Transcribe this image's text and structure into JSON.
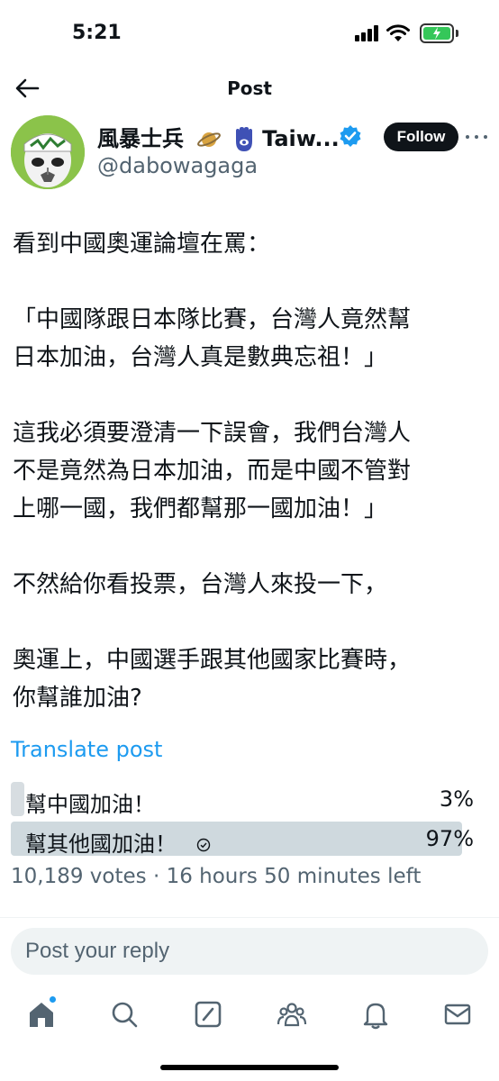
{
  "status_bar": {
    "time": "5:21"
  },
  "header": {
    "title": "Post"
  },
  "author": {
    "display_name": "風暴士兵",
    "name_suffix": "Taiw...",
    "emojis": [
      "saturn-emoji",
      "hamsa-emoji"
    ],
    "handle": "@dabowagaga",
    "follow_label": "Follow"
  },
  "post": {
    "lines": [
      "看到中國奧運論壇在罵：",
      "「中國隊跟日本隊比賽，台灣人竟然幫",
      "日本加油，台灣人真是數典忘祖！」",
      "這我必須要澄清一下誤會，我們台灣人",
      "不是竟然為日本加油，而是中國不管對",
      "上哪一國，我們都幫那一國加油！」",
      "不然給你看投票，台灣人來投一下，",
      "奧運上，中國選手跟其他國家比賽時，",
      "你幫誰加油?"
    ]
  },
  "translate_label": "Translate post",
  "poll": {
    "options": [
      {
        "label": "幫中國加油！",
        "percent_label": "3%",
        "percent": 3,
        "selected": false
      },
      {
        "label": "幫其他國加油！",
        "percent_label": "97%",
        "percent": 97,
        "selected": true
      }
    ],
    "votes": "10,189 votes",
    "separator": "·",
    "time_left": "16 hours 50 minutes left"
  },
  "reply": {
    "placeholder": "Post your reply"
  },
  "tabs": [
    {
      "name": "home",
      "icon": "home-icon"
    },
    {
      "name": "search",
      "icon": "search-icon"
    },
    {
      "name": "grok",
      "icon": "grok-icon"
    },
    {
      "name": "communities",
      "icon": "people-icon"
    },
    {
      "name": "notifications",
      "icon": "bell-icon"
    },
    {
      "name": "messages",
      "icon": "mail-icon"
    }
  ],
  "colors": {
    "accent": "#1d9bf0",
    "text": "#0f1419",
    "muted": "#536471",
    "poll_bar": "#cfd9de",
    "battery": "#35c759"
  }
}
